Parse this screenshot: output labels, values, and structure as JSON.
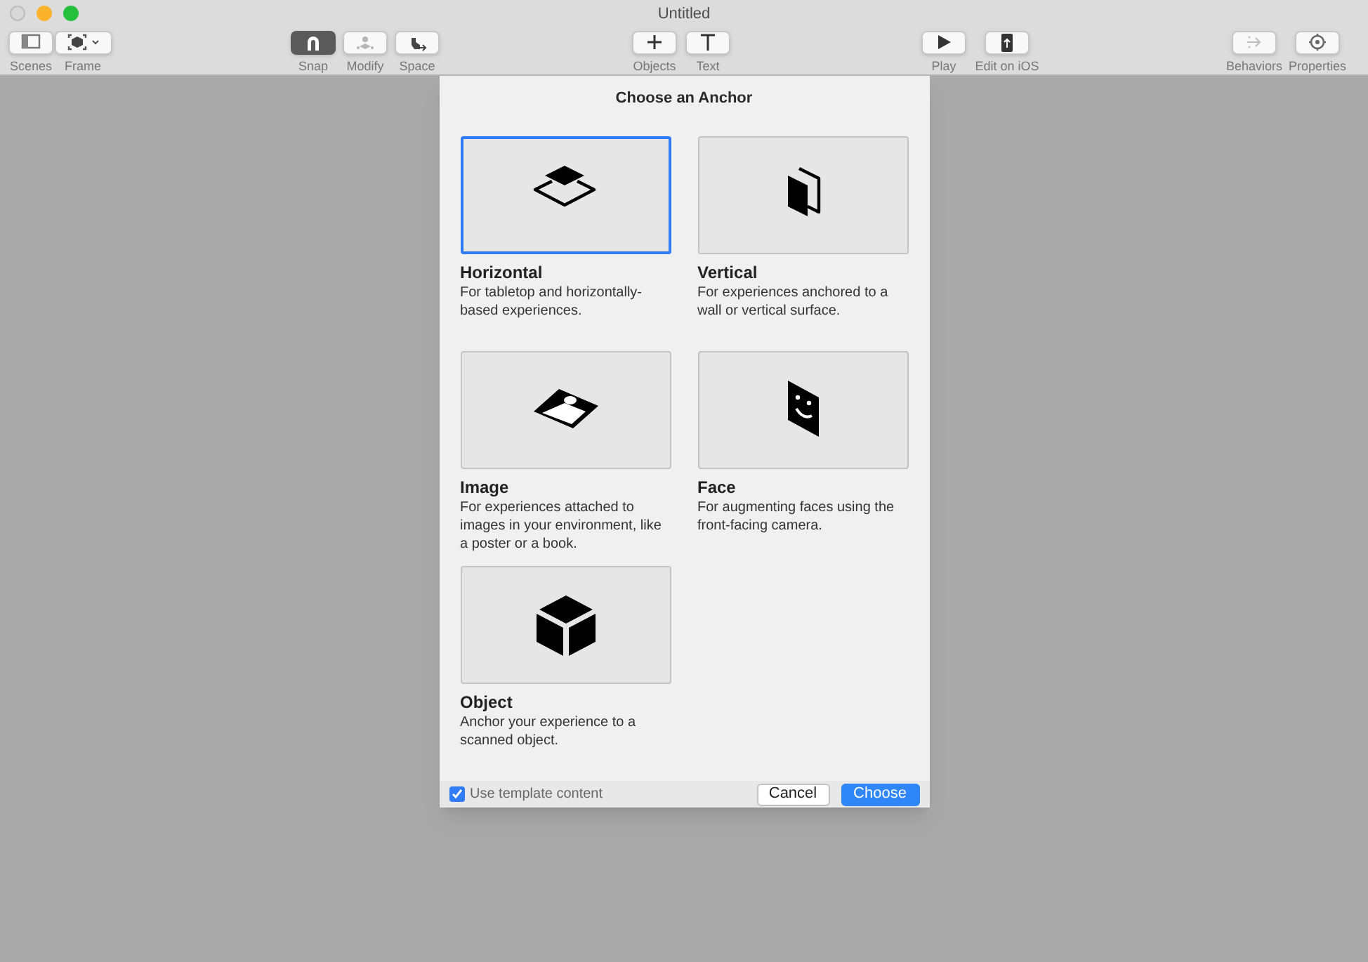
{
  "window": {
    "title": "Untitled"
  },
  "toolbar": {
    "groups": [
      [
        {
          "label": "Scenes",
          "kind": "sidebar",
          "selected": false
        },
        {
          "label": "Frame",
          "kind": "frame",
          "selected": false
        }
      ],
      [
        {
          "label": "Snap",
          "kind": "magnet",
          "selected": true
        },
        {
          "label": "Modify",
          "kind": "modify",
          "selected": false
        },
        {
          "label": "Space",
          "kind": "space",
          "selected": false
        }
      ],
      [
        {
          "label": "Objects",
          "kind": "plus",
          "selected": false
        },
        {
          "label": "Text",
          "kind": "text",
          "selected": false
        }
      ],
      [
        {
          "label": "Play",
          "kind": "play",
          "selected": false
        },
        {
          "label": "Edit on iOS",
          "kind": "device",
          "selected": false
        }
      ],
      [
        {
          "label": "Behaviors",
          "kind": "behaviors",
          "selected": false
        },
        {
          "label": "Properties",
          "kind": "gear",
          "selected": false
        }
      ]
    ]
  },
  "dialog": {
    "title": "Choose an Anchor",
    "anchors": [
      {
        "kind": "horizontal",
        "title": "Horizontal",
        "description": "For tabletop and horizontally-based experiences.",
        "selected": true
      },
      {
        "kind": "vertical",
        "title": "Vertical",
        "description": "For experiences anchored to a wall or vertical surface.",
        "selected": false
      },
      {
        "kind": "image",
        "title": "Image",
        "description": "For experiences attached to images in your environment, like a poster or a book.",
        "selected": false
      },
      {
        "kind": "face",
        "title": "Face",
        "description": "For augmenting faces using the front-facing camera.",
        "selected": false
      },
      {
        "kind": "object",
        "title": "Object",
        "description": "Anchor your experience to a scanned object.",
        "selected": false
      }
    ],
    "template_checkbox": {
      "label": "Use template content",
      "checked": true
    },
    "buttons": [
      {
        "label": "Cancel",
        "kind": "normal"
      },
      {
        "label": "Choose",
        "kind": "default"
      }
    ]
  }
}
